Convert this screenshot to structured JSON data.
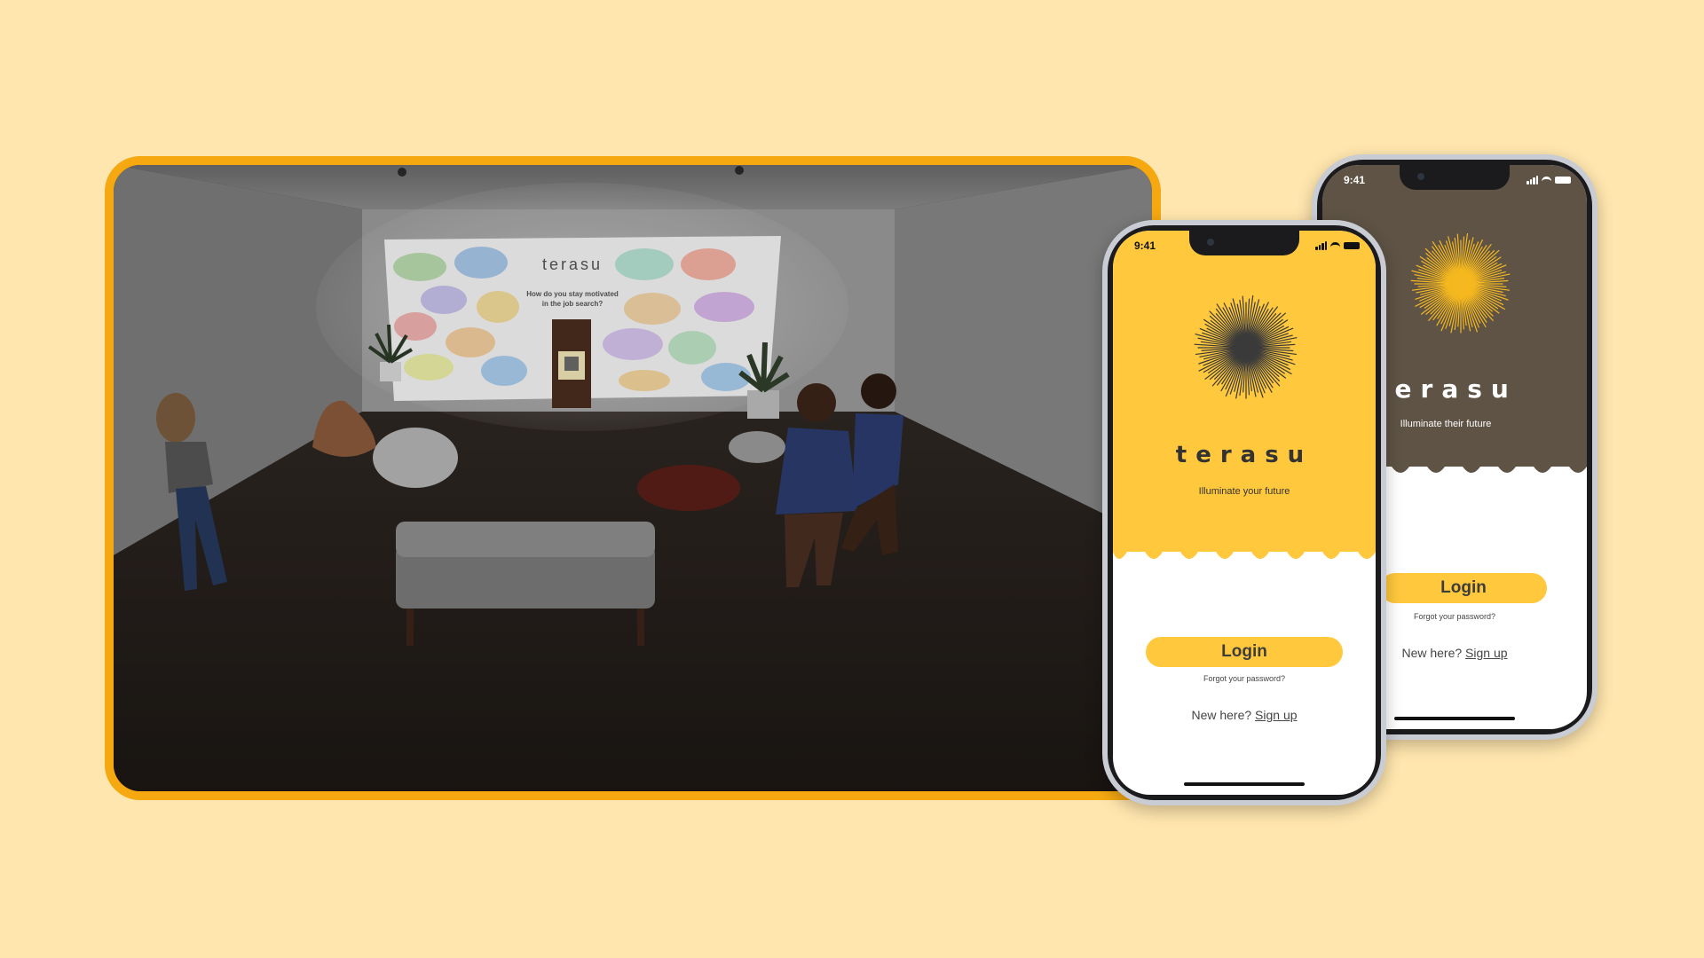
{
  "room_scene": {
    "screen_brand": "terasu",
    "screen_question_line1": "How do you stay motivated",
    "screen_question_line2": "in the job search?"
  },
  "phone_front": {
    "status_time": "9:41",
    "brand": "terasu",
    "tagline": "Illuminate your future",
    "login_label": "Login",
    "forgot_label": "Forgot your password?",
    "new_here": "New here?",
    "signup_label": "Sign up",
    "hero_color": "#FFC83D",
    "sun_color": "#3a3a3a"
  },
  "phone_back": {
    "status_time": "9:41",
    "brand": "terasu",
    "tagline": "Illuminate their future",
    "login_label": "Login",
    "forgot_label": "Forgot your password?",
    "new_here": "New here?",
    "signup_label": "Sign up",
    "hero_color": "#5E5345",
    "sun_color": "#F5B81F"
  },
  "colors": {
    "background": "#FFE6AE",
    "card_border": "#F5A810",
    "button": "#FFC83D"
  }
}
